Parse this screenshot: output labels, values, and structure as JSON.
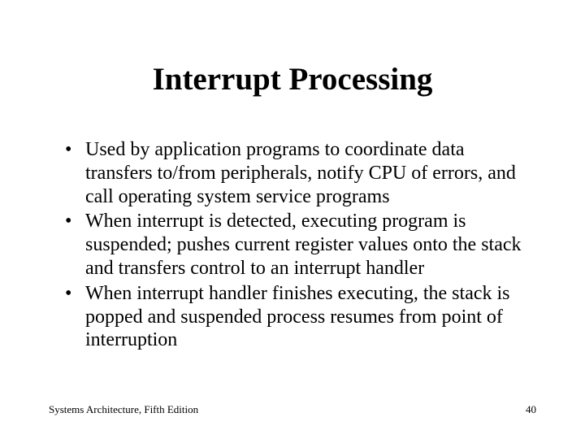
{
  "title": "Interrupt Processing",
  "bullets": [
    "Used by application programs to coordinate data transfers to/from peripherals, notify CPU of errors, and call operating system service programs",
    "When interrupt is detected, executing program is suspended; pushes current register values onto the stack and transfers control to an interrupt handler",
    "When interrupt handler finishes executing, the stack is popped and suspended process resumes from point of interruption"
  ],
  "footer": {
    "left": "Systems Architecture, Fifth Edition",
    "right": "40"
  }
}
